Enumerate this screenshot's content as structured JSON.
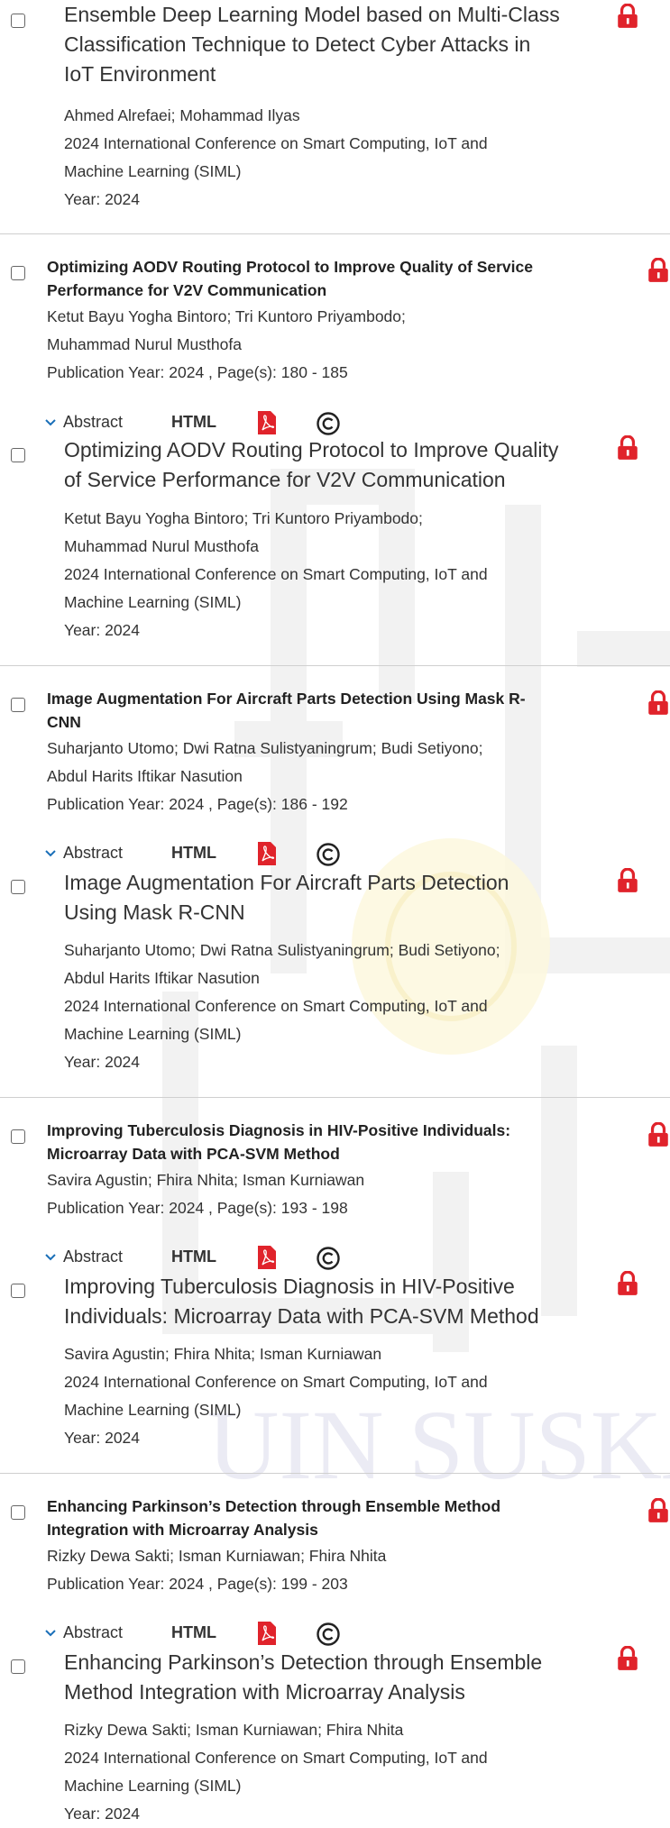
{
  "colors": {
    "lock": "#e0232b",
    "pdf": "#e0232b",
    "separator": "#cfcfcf",
    "watermark": "#f3f3f3",
    "watermark_gold": "#fcf7dc"
  },
  "watermark_text": "UIN SUSKA R",
  "items": [
    {
      "full_title": "Ensemble Deep Learning Model based on Multi-Class Classification Technique to Detect Cyber Attacks in IoT Environment",
      "full_title_lines": [
        "Ensemble Deep Learning Model based on Multi-Class",
        "Classification Technique to Detect Cyber Attacks in",
        "IoT Environment"
      ],
      "authors_lines": [
        "Ahmed Alrefaei; Mohammad Ilyas"
      ],
      "conference_lines": [
        "2024 International Conference on Smart Computing, IoT and",
        "Machine Learning (SIML)"
      ],
      "year": "Year: 2024"
    },
    {
      "bold_title_lines": [
        "Optimizing AODV Routing Protocol to Improve Quality of Service",
        "Performance for V2V Communication"
      ],
      "bold_authors_lines": [
        "Ketut Bayu Yogha Bintoro; Tri Kuntoro Priyambodo;",
        "Muhammad Nurul Musthofa"
      ],
      "publication": "Publication Year: 2024 , Page(s): 180  -  185",
      "abstract_label": "Abstract",
      "html_label": "HTML",
      "full_title_lines": [
        "Optimizing AODV Routing Protocol to Improve Quality",
        "of Service Performance for V2V Communication"
      ],
      "authors_lines": [
        "Ketut Bayu Yogha Bintoro; Tri Kuntoro Priyambodo;",
        "Muhammad Nurul Musthofa"
      ],
      "conference_lines": [
        "2024 International Conference on Smart Computing, IoT and",
        "Machine Learning (SIML)"
      ],
      "year": "Year: 2024"
    },
    {
      "bold_title_lines": [
        "Image Augmentation For Aircraft Parts Detection Using Mask R-",
        "CNN"
      ],
      "bold_authors_lines": [
        "Suharjanto Utomo; Dwi Ratna Sulistyaningrum; Budi Setiyono;",
        "Abdul Harits Iftikar Nasution"
      ],
      "publication": "Publication Year: 2024 , Page(s): 186  -  192",
      "abstract_label": "Abstract",
      "html_label": "HTML",
      "full_title_lines": [
        "Image Augmentation For Aircraft Parts Detection",
        "Using Mask R-CNN"
      ],
      "authors_lines": [
        "Suharjanto Utomo; Dwi Ratna Sulistyaningrum; Budi Setiyono;",
        "Abdul Harits Iftikar Nasution"
      ],
      "conference_lines": [
        "2024 International Conference on Smart Computing, IoT and",
        "Machine Learning (SIML)"
      ],
      "year": "Year: 2024"
    },
    {
      "bold_title_lines": [
        "Improving Tuberculosis Diagnosis in HIV-Positive Individuals:",
        "Microarray Data with PCA-SVM Method"
      ],
      "bold_authors_lines": [
        "Savira Agustin; Fhira Nhita; Isman Kurniawan"
      ],
      "publication": "Publication Year: 2024 , Page(s): 193  -  198",
      "abstract_label": "Abstract",
      "html_label": "HTML",
      "full_title_lines": [
        "Improving Tuberculosis Diagnosis in HIV-Positive",
        "Individuals: Microarray Data with PCA-SVM Method"
      ],
      "authors_lines": [
        "Savira Agustin; Fhira Nhita; Isman Kurniawan"
      ],
      "conference_lines": [
        "2024 International Conference on Smart Computing, IoT and",
        "Machine Learning (SIML)"
      ],
      "year": "Year: 2024"
    },
    {
      "bold_title_lines": [
        "Enhancing Parkinson’s Detection through Ensemble Method",
        "Integration with Microarray Analysis"
      ],
      "bold_authors_lines": [
        "Rizky Dewa Sakti; Isman Kurniawan; Fhira Nhita"
      ],
      "publication": "Publication Year: 2024 , Page(s): 199  -  203",
      "abstract_label": "Abstract",
      "html_label": "HTML",
      "full_title_lines": [
        "Enhancing Parkinson’s Detection through Ensemble",
        "Method Integration with Microarray Analysis"
      ],
      "authors_lines": [
        "Rizky Dewa Sakti; Isman Kurniawan; Fhira Nhita"
      ],
      "conference_lines": [
        "2024 International Conference on Smart Computing, IoT and",
        "Machine Learning (SIML)"
      ],
      "year": "Year: 2024"
    }
  ]
}
